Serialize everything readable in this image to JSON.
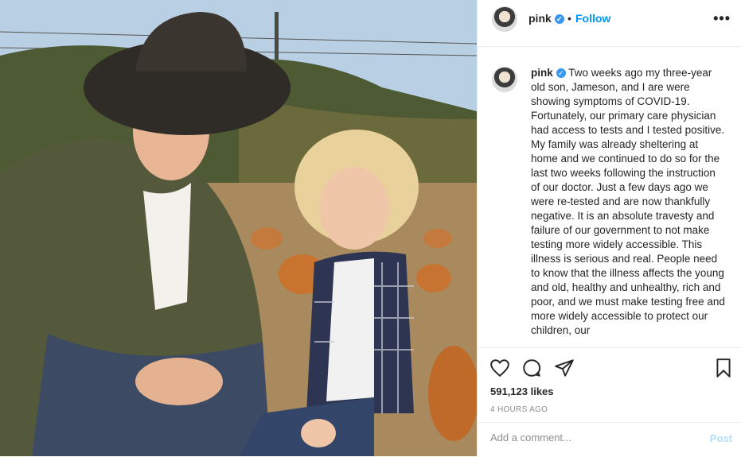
{
  "post": {
    "username": "pink",
    "follow_label": "Follow",
    "separator": "•",
    "more_label": "•••",
    "caption_text": "Two weeks ago my three-year old son, Jameson, and I are were showing symptoms of COVID-19. Fortunately, our primary care physician had access to tests and I tested positive. My family was already sheltering at home and we continued to do so for the last two weeks following the instruction of our doctor. Just a few days ago we were re-tested and are now thankfully negative. It is an absolute travesty and failure of our government to not make testing more widely accessible. This illness is serious and real. People need to know that the illness affects the young and old, healthy and unhealthy, rich and poor, and we must make testing free and more widely accessible to protect our children, our",
    "likes": "591,123 likes",
    "time": "4 HOURS AGO",
    "verified_mark": "✓"
  },
  "comment": {
    "placeholder": "Add a comment...",
    "post_label": "Post"
  },
  "colors": {
    "accent": "#0095f6",
    "post_disabled": "#b2dffc",
    "verified": "#3897f0"
  },
  "icons": [
    "heart-icon",
    "comment-icon",
    "share-icon",
    "bookmark-icon",
    "more-options-icon",
    "verified-badge-icon"
  ]
}
